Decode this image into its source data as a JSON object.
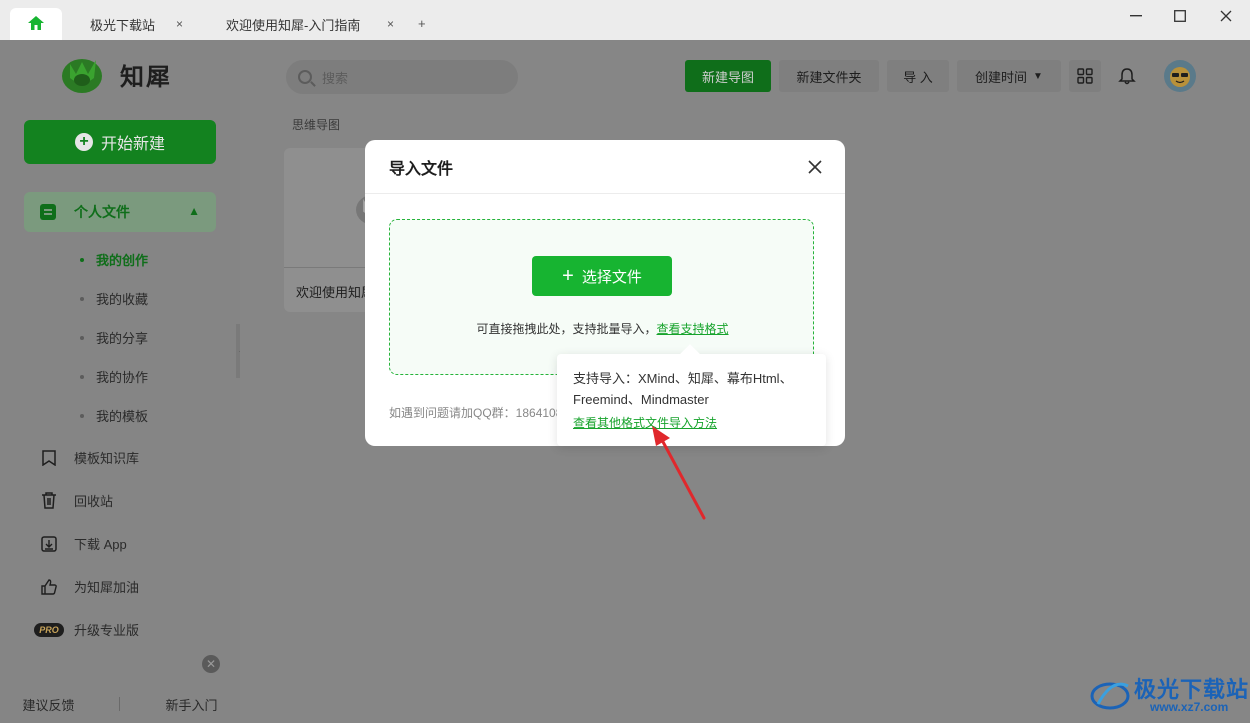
{
  "tabs": [
    {
      "label": "极光下载站"
    },
    {
      "label": "欢迎使用知犀-入门指南"
    }
  ],
  "tab_close_glyph": "×",
  "tab_new_glyph": "+",
  "sidebar": {
    "logo_text": "知犀",
    "start_button": "开始新建",
    "personal_files": "个人文件",
    "sub_items": [
      {
        "label": "我的创作"
      },
      {
        "label": "我的收藏"
      },
      {
        "label": "我的分享"
      },
      {
        "label": "我的协作"
      },
      {
        "label": "我的模板"
      }
    ],
    "nav_items": [
      {
        "label": "模板知识库",
        "icon": "bookmark-icon"
      },
      {
        "label": "回收站",
        "icon": "trash-icon"
      },
      {
        "label": "下载 App",
        "icon": "download-icon"
      },
      {
        "label": "为知犀加油",
        "icon": "thumbs-up-icon"
      },
      {
        "label": "升级专业版",
        "icon": "pro-badge"
      }
    ],
    "pro_badge": "PRO",
    "footer": {
      "feedback": "建议反馈",
      "guide": "新手入门"
    }
  },
  "toolbar": {
    "search_placeholder": "搜索",
    "new_mindmap": "新建导图",
    "new_folder": "新建文件夹",
    "import": "导 入",
    "sort": "创建时间"
  },
  "main": {
    "section_label": "思维导图",
    "card_title": "欢迎使用知犀-入门指南"
  },
  "modal": {
    "title": "导入文件",
    "select_button": "选择文件",
    "drop_hint": "可直接拖拽此处，支持批量导入，",
    "drop_hint_link": "查看支持格式",
    "qq_note": "如遇到问题请加QQ群：1864108"
  },
  "tooltip": {
    "text": "支持导入：XMind、知犀、幕布Html、Freemind、Mindmaster",
    "link": "查看其他格式文件导入方法"
  },
  "watermark": {
    "text": "极光下载站",
    "url": "www.xz7.com"
  },
  "colors": {
    "accent": "#17b431",
    "accent_dark": "#0f6e1a",
    "link": "#17a32c",
    "watermark": "#1b63b7"
  }
}
